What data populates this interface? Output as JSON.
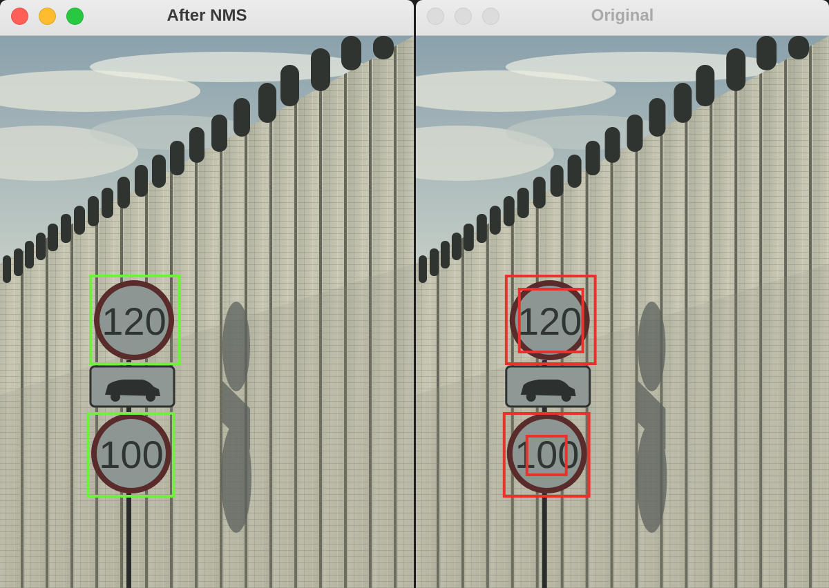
{
  "windows": [
    {
      "title": "After NMS",
      "active": true,
      "traffic_colors": {
        "close": "#ff5f57",
        "minimize": "#febc2e",
        "zoom": "#28c840"
      }
    },
    {
      "title": "Original",
      "active": false,
      "traffic_colors": {
        "close": "#dcdcdc",
        "minimize": "#dcdcdc",
        "zoom": "#dcdcdc"
      }
    }
  ],
  "image": {
    "sign_top_text": "120",
    "sign_bottom_text": "100"
  },
  "box_colors": {
    "after_nms": "#6ef03c",
    "original": "#e8322c"
  }
}
